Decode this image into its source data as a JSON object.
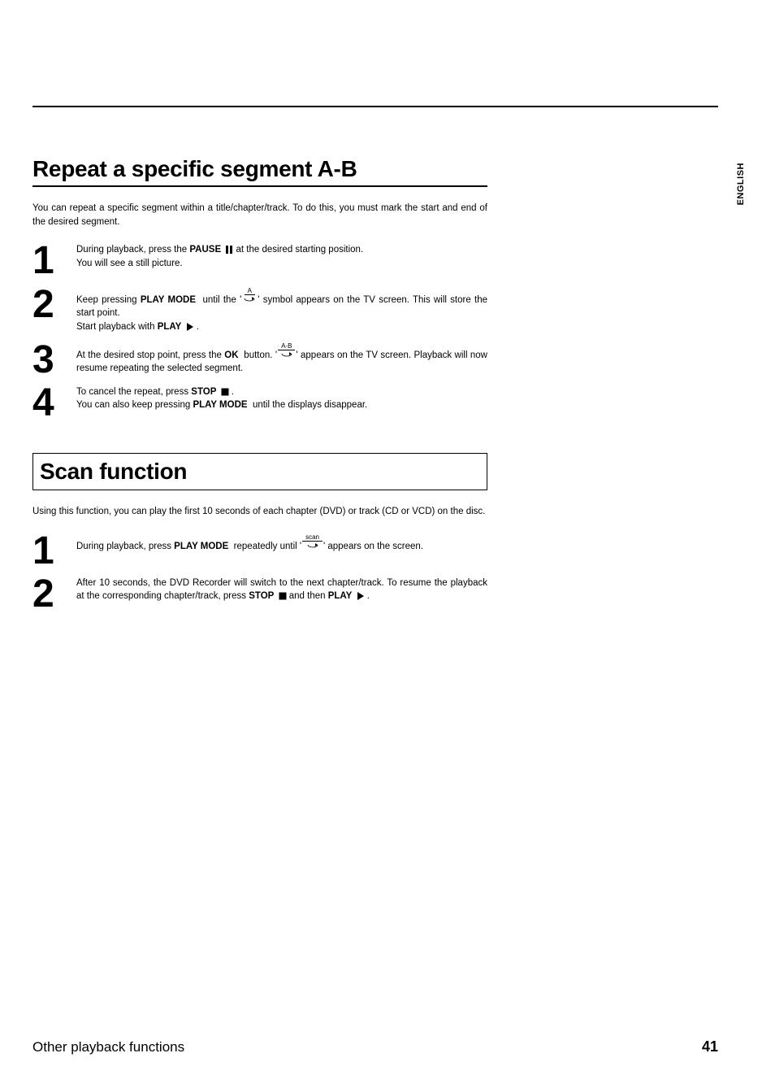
{
  "lang_tab": "ENGLISH",
  "footer": {
    "section_title": "Other playback functions",
    "page_number": "41"
  },
  "section_a": {
    "heading": "Repeat a specific segment A-B",
    "intro": "You can repeat a specific segment within a title/chapter/track. To do this, you must mark the start and end of the desired segment.",
    "steps": [
      {
        "n": "1",
        "parts": [
          {
            "t": "During playback, press the "
          },
          {
            "k": "PAUSE",
            "glyph": "pause"
          },
          {
            "t": " at the desired starting position."
          },
          {
            "br": true
          },
          {
            "t": "You will see a still picture."
          }
        ]
      },
      {
        "n": "2",
        "parts": [
          {
            "t": "Keep pressing "
          },
          {
            "k": "PLAY MODE"
          },
          {
            "t": " until the '"
          },
          {
            "icon": "loop-a"
          },
          {
            "t": "' symbol appears on the TV screen. This will store the start point."
          },
          {
            "br": true
          },
          {
            "t": "Start playback with "
          },
          {
            "k": "PLAY",
            "glyph": "play"
          },
          {
            "t": " ."
          }
        ]
      },
      {
        "n": "3",
        "parts": [
          {
            "t": "At the desired stop point, press the "
          },
          {
            "k": "OK"
          },
          {
            "t": " button. '"
          },
          {
            "icon": "loop-ab"
          },
          {
            "t": "' appears on the TV screen. Playback will now resume repeating the selected segment."
          }
        ]
      },
      {
        "n": "4",
        "parts": [
          {
            "t": "To cancel the repeat, press "
          },
          {
            "k": "STOP",
            "glyph": "stop"
          },
          {
            "t": " ."
          },
          {
            "br": true
          },
          {
            "t": "You can also keep pressing "
          },
          {
            "k": "PLAY MODE"
          },
          {
            "t": " until the displays disappear."
          }
        ]
      }
    ]
  },
  "section_b": {
    "heading": "Scan function",
    "intro": "Using this function, you can play the first 10 seconds of each chapter (DVD) or track (CD or VCD) on the disc.",
    "steps": [
      {
        "n": "1",
        "parts": [
          {
            "t": "During playback, press "
          },
          {
            "k": "PLAY MODE"
          },
          {
            "t": " repeatedly until '"
          },
          {
            "icon": "scan"
          },
          {
            "t": "' appears on the screen."
          }
        ]
      },
      {
        "n": "2",
        "parts": [
          {
            "t": "After 10 seconds, the DVD Recorder will switch to the next chapter/track. To resume the playback at the corresponding chapter/track, press "
          },
          {
            "k": "STOP",
            "glyph": "stop"
          },
          {
            "t": " and then "
          },
          {
            "k": "PLAY",
            "glyph": "play"
          },
          {
            "t": " ."
          }
        ]
      }
    ]
  },
  "icons": {
    "pause": {
      "name": "pause-icon"
    },
    "play": {
      "name": "play-icon"
    },
    "stop": {
      "name": "stop-icon"
    },
    "loop-a": {
      "name": "repeat-a-icon",
      "label": "A"
    },
    "loop-ab": {
      "name": "repeat-ab-icon",
      "label": "A-B"
    },
    "scan": {
      "name": "scan-icon",
      "label": "scan"
    }
  }
}
